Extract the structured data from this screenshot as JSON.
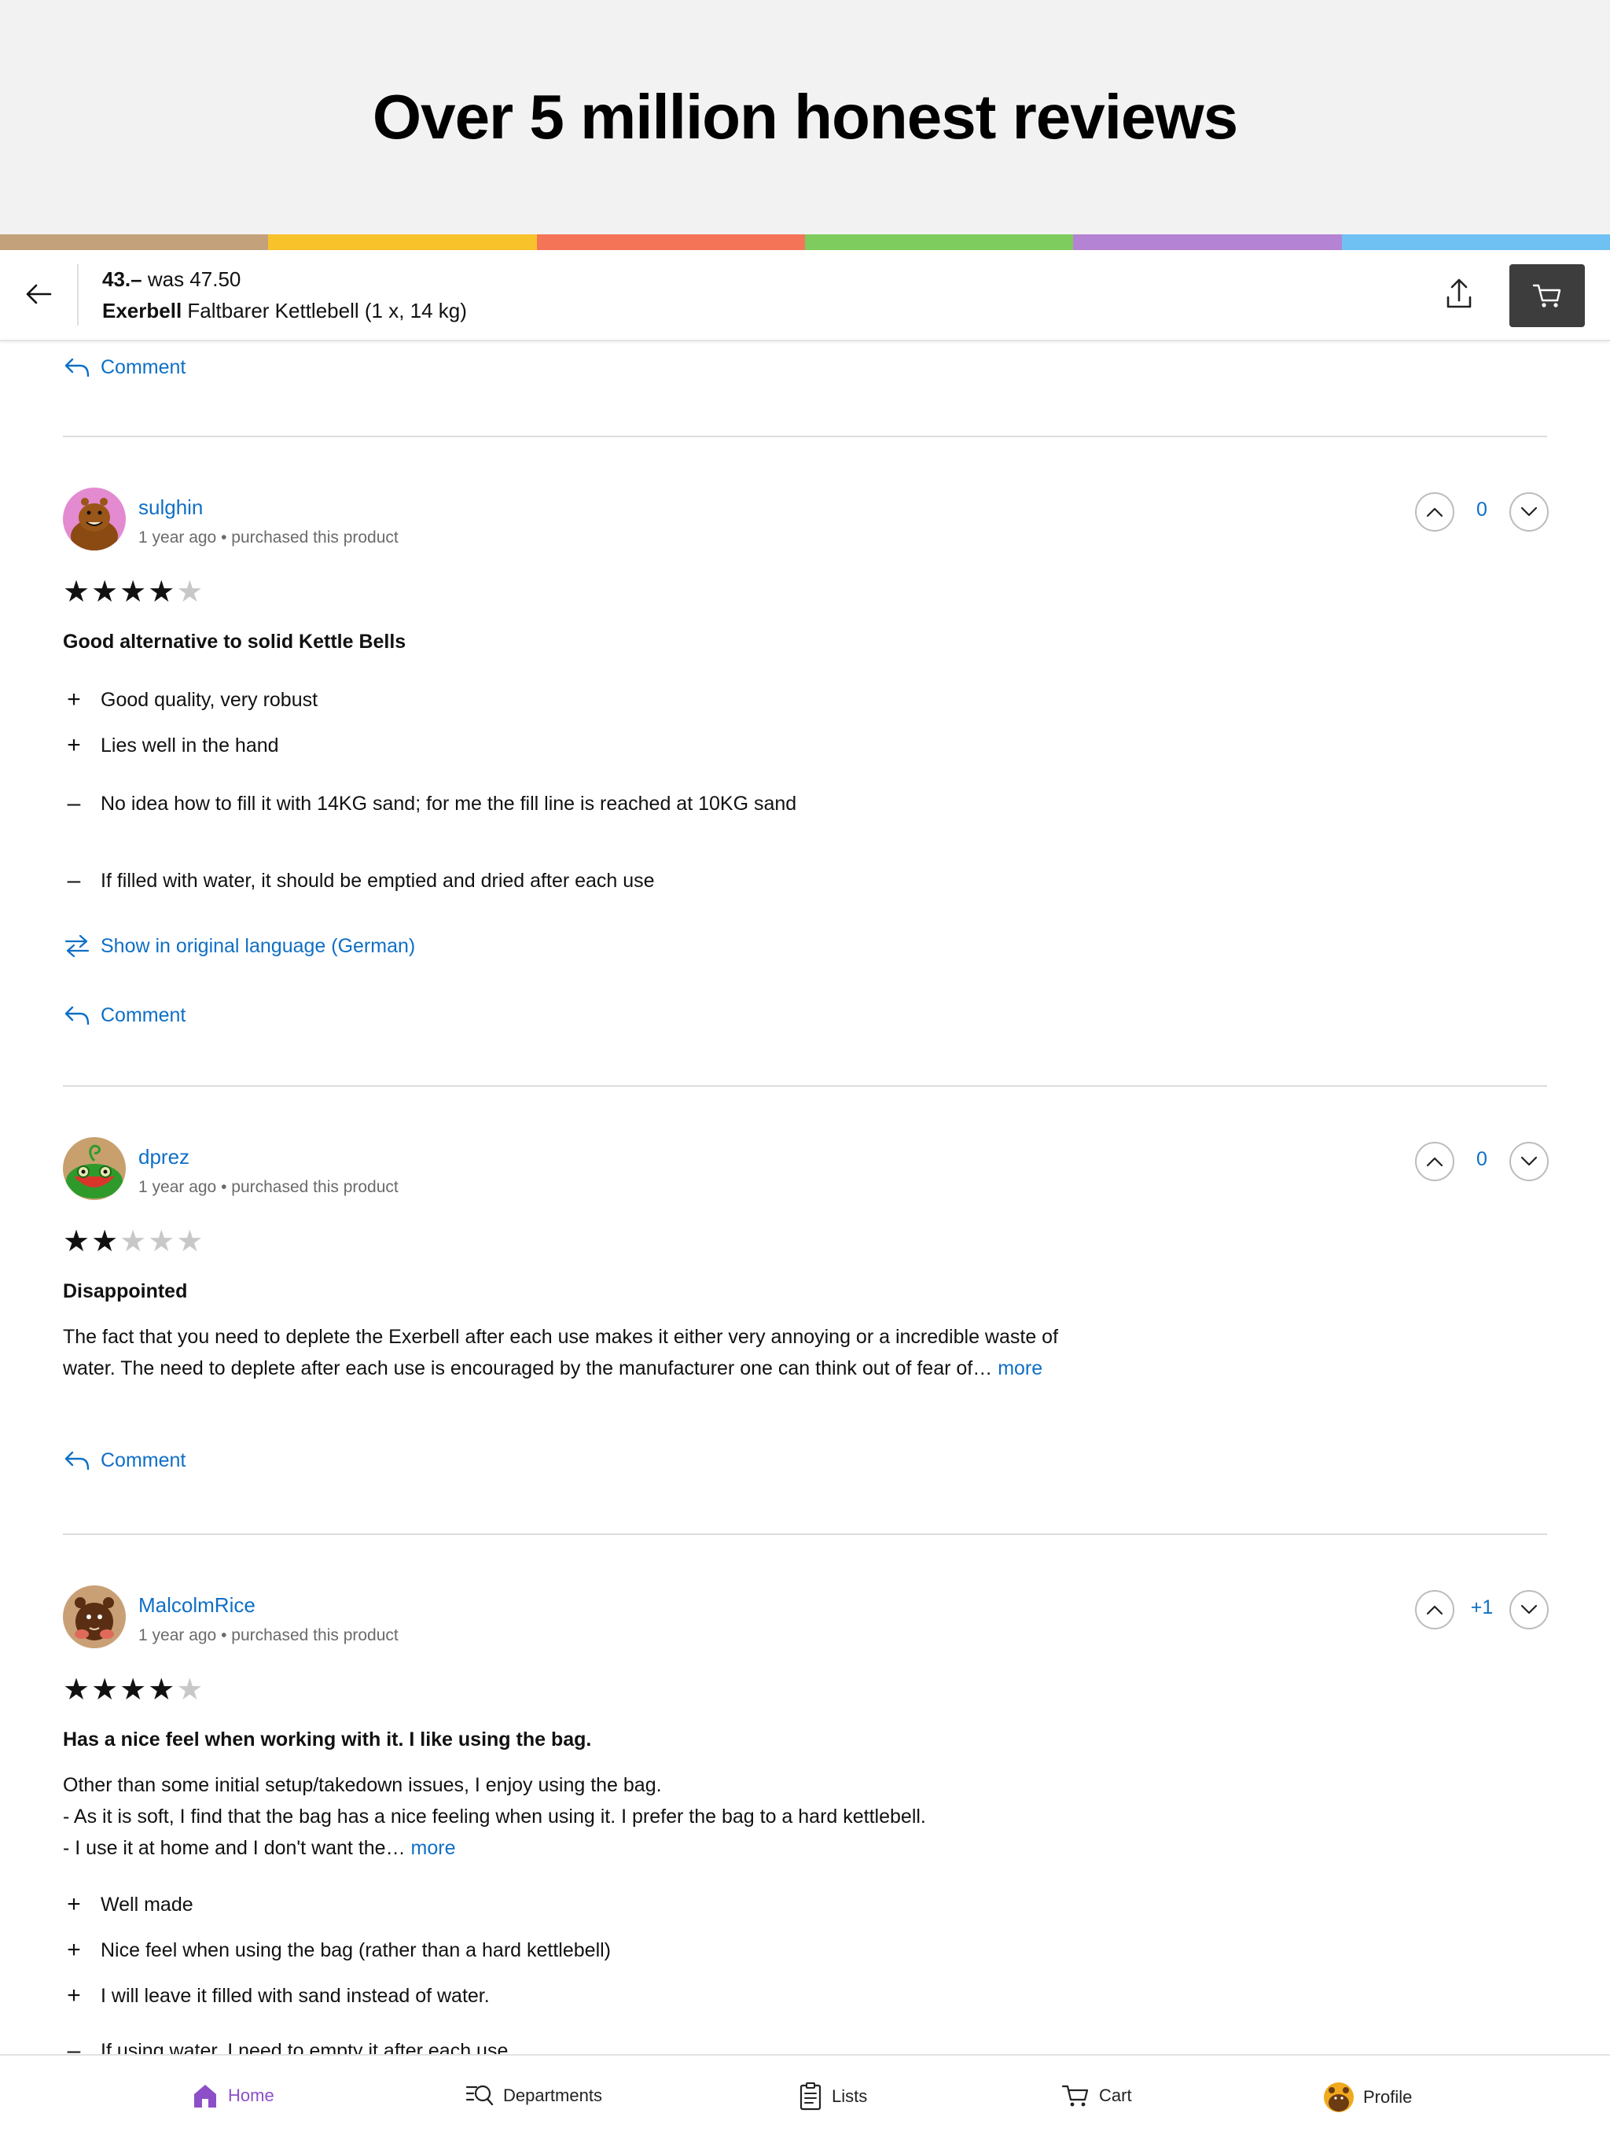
{
  "banner": {
    "title": "Over 5 million honest reviews"
  },
  "stripe_colors": [
    "#c3a17a",
    "#f8c22b",
    "#f47458",
    "#7ecc5d",
    "#b483d4",
    "#70c1f3"
  ],
  "product_bar": {
    "price": "43.–",
    "was_label": "was 47.50",
    "brand": "Exerbell",
    "name": "Faltbarer Kettlebell (1 x, 14 kg)"
  },
  "prev_review": {
    "comment_label": "Comment"
  },
  "reviews": [
    {
      "username": "sulghin",
      "time": "1 year ago",
      "purchased": "purchased this product",
      "rating": 4,
      "title": "Good alternative to solid Kettle Bells",
      "pros": [
        "Good quality, very robust",
        "Lies well in the hand"
      ],
      "cons": [
        "No idea how to fill it with 14KG sand; for me the fill line is reached at 10KG sand",
        "If filled with water, it should be emptied and dried after each use"
      ],
      "translate_label": "Show in original language (German)",
      "comment_label": "Comment",
      "votes": "0"
    },
    {
      "username": "dprez",
      "time": "1 year ago",
      "purchased": "purchased this product",
      "rating": 2,
      "title": "Disappointed",
      "body": "The fact that you need to deplete the Exerbell after each use makes it either very annoying or a incredible waste of water. The need to deplete after each use is encouraged by the manufacturer one can think out of fear of…",
      "more_label": "more",
      "comment_label": "Comment",
      "votes": "0"
    },
    {
      "username": "MalcolmRice",
      "time": "1 year ago",
      "purchased": "purchased this product",
      "rating": 4,
      "title": "Has a nice feel when working with it. I like using the bag.",
      "body_lines": [
        "Other than some initial setup/takedown issues, I enjoy using the bag.",
        "- As it is soft, I find that the bag has a nice feeling when using it. I prefer the bag to a hard kettlebell.",
        "- I use it at home and I don't want the…"
      ],
      "more_label": "more",
      "pros": [
        "Well made",
        "Nice feel when using the bag (rather than a hard kettlebell)",
        "I will leave it filled with sand instead of water."
      ],
      "cons": [
        "If using water, I need to empty it after each use"
      ],
      "votes": "+1"
    }
  ],
  "bottom_nav": {
    "home": "Home",
    "departments": "Departments",
    "lists": "Lists",
    "cart": "Cart",
    "profile": "Profile",
    "active_color": "#8d4fc8"
  }
}
